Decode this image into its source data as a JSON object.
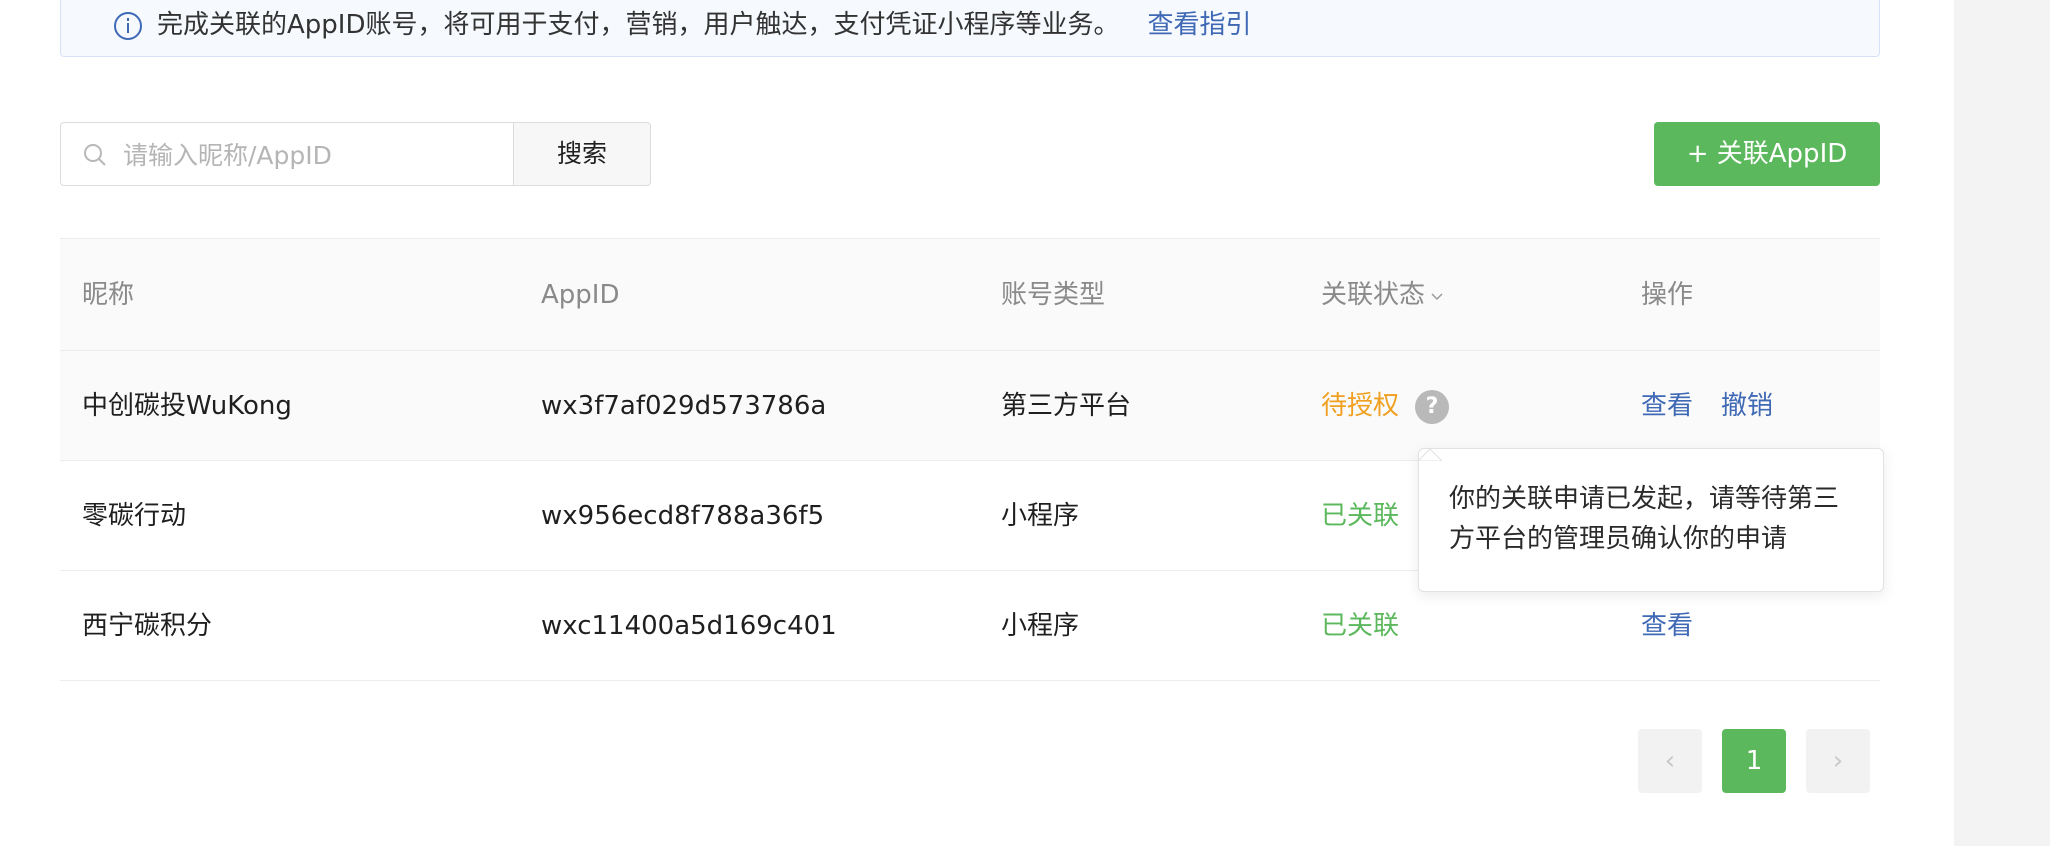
{
  "notice": {
    "text": "完成关联的AppID账号，将可用于支付，营销，用户触达，支付凭证小程序等业务。",
    "link": "查看指引"
  },
  "search": {
    "placeholder": "请输入昵称/AppID",
    "value": "",
    "button_label": "搜索"
  },
  "add_button_label": "+ 关联AppID",
  "table": {
    "headers": {
      "name": "昵称",
      "appid": "AppID",
      "type": "账号类型",
      "status": "关联状态",
      "ops": "操作"
    },
    "rows": [
      {
        "name": "中创碳投WuKong",
        "appid": "wx3f7af029d573786a",
        "type": "第三方平台",
        "status": "待授权",
        "ops": [
          "查看",
          "撤销"
        ]
      },
      {
        "name": "零碳行动",
        "appid": "wx956ecd8f788a36f5",
        "type": "小程序",
        "status": "已关联",
        "ops": []
      },
      {
        "name": "西宁碳积分",
        "appid": "wxc11400a5d169c401",
        "type": "小程序",
        "status": "已关联",
        "ops": [
          "查看"
        ]
      }
    ]
  },
  "tooltip": {
    "text": "你的关联申请已发起，请等待第三方平台的管理员确认你的申请"
  },
  "pagination": {
    "prev": "‹",
    "current": "1",
    "next": "›"
  },
  "colors": {
    "primary_green": "#5cb85c",
    "link_blue": "#3f68b5",
    "pending_orange": "#f0a020"
  }
}
